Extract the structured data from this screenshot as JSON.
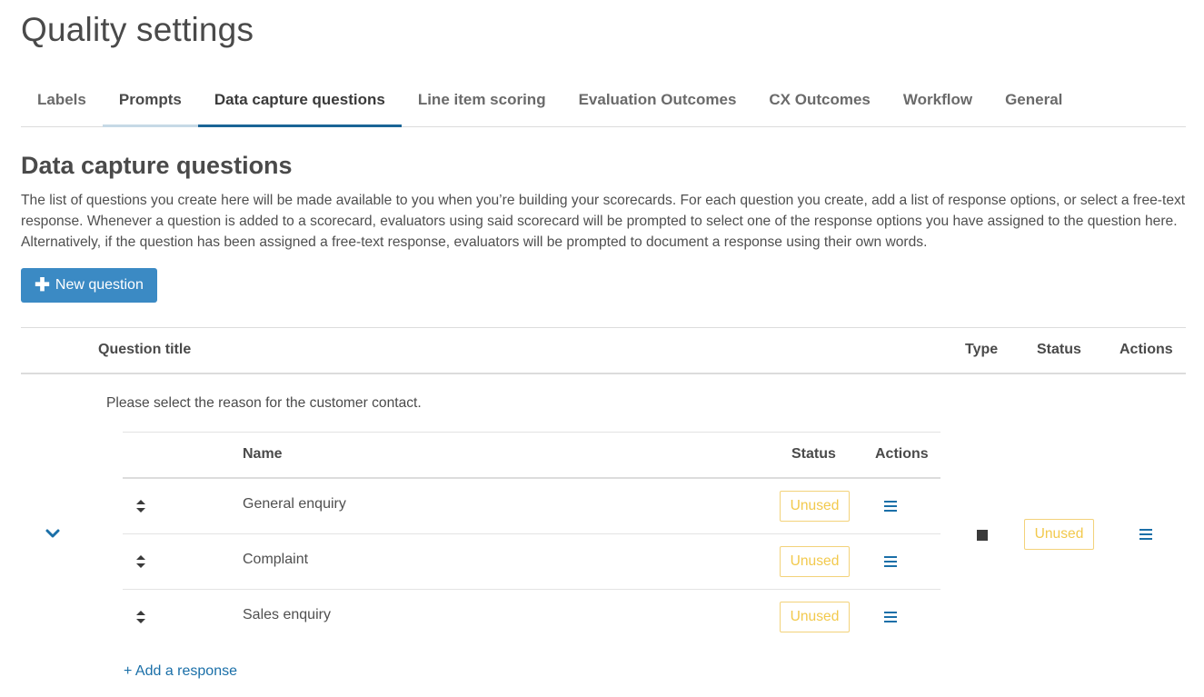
{
  "page_title": "Quality settings",
  "tabs": [
    {
      "label": "Labels"
    },
    {
      "label": "Prompts"
    },
    {
      "label": "Data capture questions"
    },
    {
      "label": "Line item scoring"
    },
    {
      "label": "Evaluation Outcomes"
    },
    {
      "label": "CX Outcomes"
    },
    {
      "label": "Workflow"
    },
    {
      "label": "General"
    }
  ],
  "active_tab": "Data capture questions",
  "section": {
    "title": "Data capture questions",
    "description": "The list of questions you create here will be made available to you when you’re building your scorecards. For each question you create, add a list of response options, or select a free-text response. Whenever a question is added to a scorecard, evaluators using said scorecard will be prompted to select one of the response options you have assigned to the question here. Alternatively, if the question has been assigned a free-text response, evaluators will be prompted to document a response using their own words."
  },
  "new_question_label": "New question",
  "table": {
    "headers": {
      "title": "Question title",
      "type": "Type",
      "status": "Status",
      "actions": "Actions"
    },
    "question": {
      "text": "Please select the reason for the customer contact.",
      "status": "Unused",
      "type_icon": "square-icon",
      "responses_headers": {
        "name": "Name",
        "status": "Status",
        "actions": "Actions"
      },
      "responses": [
        {
          "name": "General enquiry",
          "status": "Unused"
        },
        {
          "name": "Complaint",
          "status": "Unused"
        },
        {
          "name": "Sales enquiry",
          "status": "Unused"
        }
      ],
      "add_response_label": "+ Add a response"
    }
  },
  "colors": {
    "accent": "#3b8ac4",
    "active_tab": "#1a6496",
    "link": "#1a6fa8",
    "badge_border": "#f3d27a",
    "badge_text": "#f2c94c"
  }
}
